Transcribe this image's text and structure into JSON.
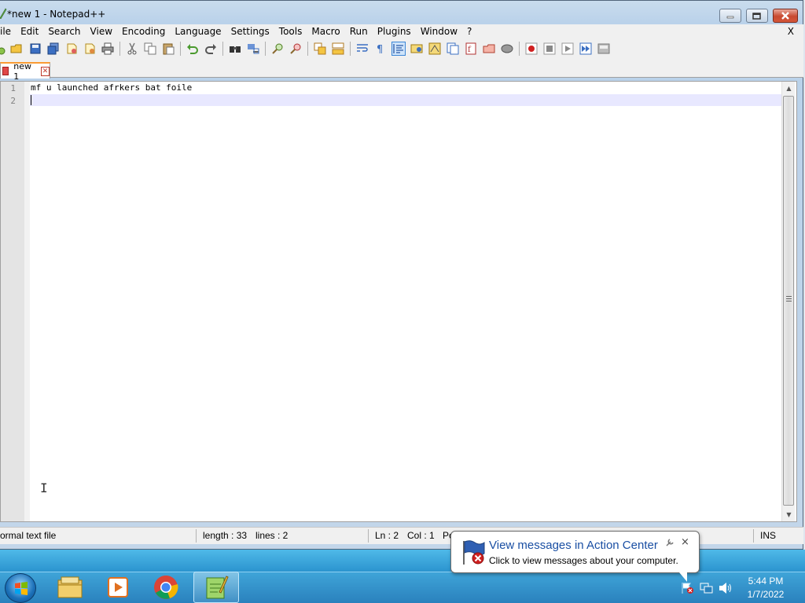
{
  "window": {
    "title": "*new 1 - Notepad++"
  },
  "menu": {
    "items": [
      "ile",
      "Edit",
      "Search",
      "View",
      "Encoding",
      "Language",
      "Settings",
      "Tools",
      "Macro",
      "Run",
      "Plugins",
      "Window",
      "?"
    ],
    "close_doc": "X"
  },
  "tabs": [
    {
      "label": "new 1",
      "modified": true
    }
  ],
  "editor": {
    "lines": [
      "mf u launched afrkers bat foile",
      ""
    ],
    "line_numbers": [
      "1",
      "2"
    ],
    "current_line": 2
  },
  "status": {
    "file_type": "ormal text file",
    "length": "length : 33",
    "lines": "lines : 2",
    "ln": "Ln : 2",
    "col": "Col : 1",
    "pos": "Po",
    "mode": "INS"
  },
  "balloon": {
    "title": "View messages in Action Center",
    "text": "Click to view messages about your computer.",
    "close": "×"
  },
  "tray": {
    "time": "5:44 PM",
    "date": "1/7/2022"
  },
  "colors": {
    "tab_accent": "#fa9b33",
    "current_line": "#e8e8ff",
    "balloon_title": "#1a4fa3",
    "taskbar": "#2a8ccc"
  },
  "icons": {
    "toolbar": [
      "new-icon",
      "open-icon",
      "save-icon",
      "save-all-icon",
      "close-icon",
      "close-all-icon",
      "print-icon",
      "cut-icon",
      "copy-icon",
      "paste-icon",
      "undo-icon",
      "redo-icon",
      "find-icon",
      "replace-icon",
      "zoom-in-icon",
      "zoom-out-icon",
      "sync-vertical-icon",
      "sync-horizontal-icon",
      "word-wrap-icon",
      "show-all-chars-icon",
      "indent-guide-icon",
      "user-language-icon",
      "doc-map-icon",
      "function-list-icon",
      "folder-as-workspace-icon",
      "doc-switcher-icon",
      "monitoring-icon",
      "record-macro-icon",
      "stop-record-icon",
      "play-macro-icon",
      "run-macro-multiple-icon",
      "save-macro-icon"
    ],
    "taskbar": [
      "start-orb-icon",
      "explorer-icon",
      "media-player-icon",
      "chrome-icon",
      "notepadpp-icon"
    ]
  }
}
